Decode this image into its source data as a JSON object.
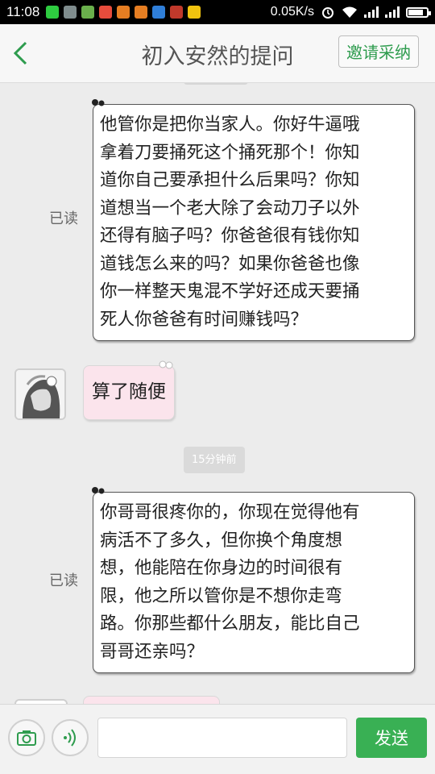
{
  "status_bar": {
    "time": "11:08",
    "network_speed": "0.05K/s",
    "notification_icons": [
      {
        "name": "wechat-icon",
        "color": "#2ecc40"
      },
      {
        "name": "app-icon-2",
        "color": "#7f8c8d"
      },
      {
        "name": "question-icon",
        "color": "#6ab04c"
      },
      {
        "name": "app-icon-4",
        "color": "#e74c3c"
      },
      {
        "name": "app-icon-5",
        "color": "#e67e22"
      },
      {
        "name": "app-icon-6",
        "color": "#e67e22"
      },
      {
        "name": "upload-icon",
        "color": "#2f7ed8"
      },
      {
        "name": "app-icon-8",
        "color": "#c0392b"
      },
      {
        "name": "folder-icon",
        "color": "#f1c40f"
      }
    ]
  },
  "header": {
    "title": "初入安然的提问",
    "invite_button_label": "邀请采纳",
    "accent_color": "#2e9c4e"
  },
  "messages": [
    {
      "side": "right",
      "read_status": "已读",
      "lines": [
        "他管你是把你当家人。你好牛逼哦",
        "拿着刀要捅死这个捅死那个！你知",
        "道你自己要承担什么后果吗？你知",
        "道想当一个老大除了会动刀子以外",
        "还得有脑子吗？你爸爸很有钱你知",
        "道钱怎么来的吗？如果你爸爸也像",
        "你一样整天鬼混不学好还成天要捅",
        "死人你爸爸有时间赚钱吗？"
      ]
    },
    {
      "side": "left",
      "text": "算了随便"
    },
    {
      "side": "right",
      "read_status": "已读",
      "lines": [
        "你哥哥很疼你的，你现在觉得他有",
        "病活不了多久，但你换个角度想",
        "想，他能陪在你身边的时间很有",
        "限，他之所以管你是不想你走弯",
        "路。你那些都什么朋友，能比自己",
        "哥哥还亲吗？"
      ]
    }
  ],
  "time_divider": "15分钟前",
  "input_bar": {
    "camera_icon": "camera-icon",
    "voice_icon": "voice-icon",
    "input_value": "",
    "send_label": "发送",
    "send_color": "#39b054"
  }
}
